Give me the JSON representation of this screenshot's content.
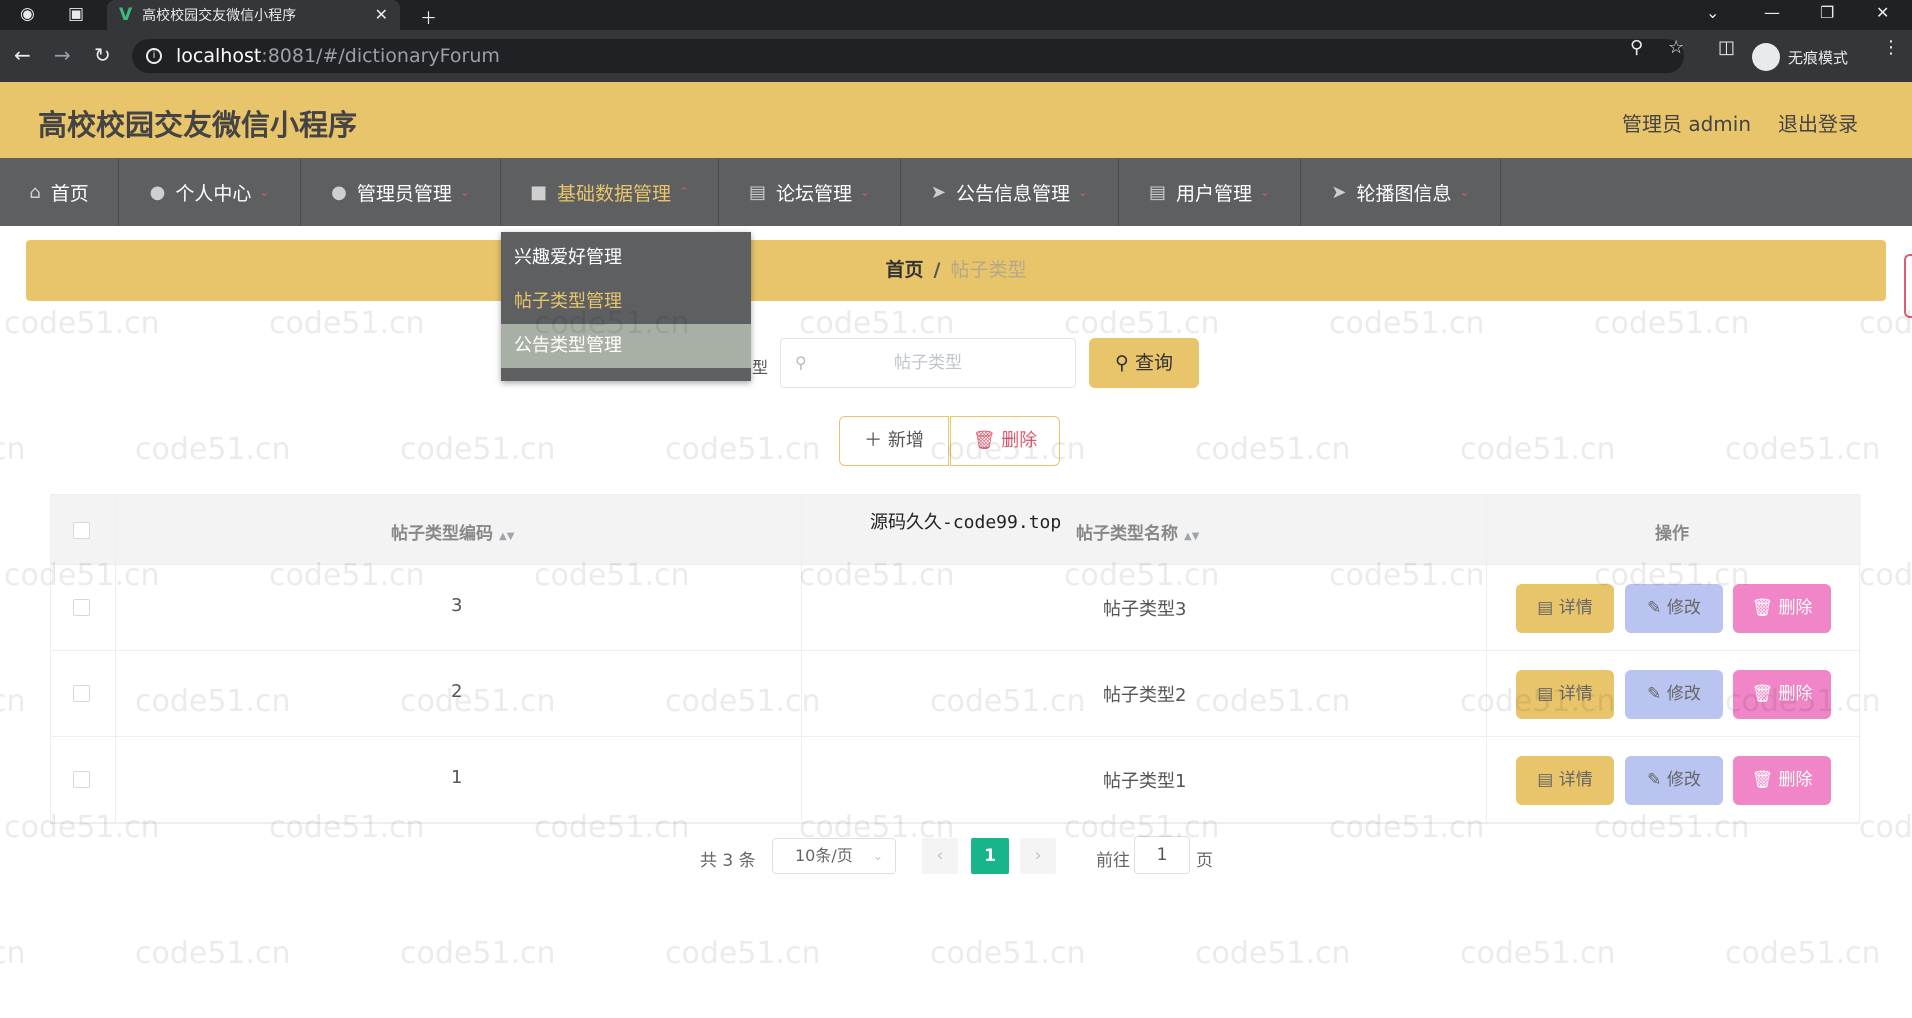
{
  "browser": {
    "tab_title": "高校校园交友微信小程序",
    "url_host": "localhost",
    "url_path": ":8081/#/dictionaryForum",
    "incognito_label": "无痕模式"
  },
  "header": {
    "title": "高校校园交友微信小程序",
    "admin_label": "管理员 admin",
    "logout_label": "退出登录"
  },
  "nav": {
    "items": [
      {
        "label": "首页",
        "icon": "home-icon"
      },
      {
        "label": "个人中心",
        "icon": "user-icon"
      },
      {
        "label": "管理员管理",
        "icon": "user-icon"
      },
      {
        "label": "基础数据管理",
        "icon": "data-icon"
      },
      {
        "label": "论坛管理",
        "icon": "forum-icon"
      },
      {
        "label": "公告信息管理",
        "icon": "send-icon"
      },
      {
        "label": "用户管理",
        "icon": "list-icon"
      },
      {
        "label": "轮播图信息",
        "icon": "send-icon"
      }
    ]
  },
  "dropdown": {
    "items": [
      "兴趣爱好管理",
      "帖子类型管理",
      "公告类型管理"
    ]
  },
  "breadcrumb": {
    "home": "首页",
    "separator": "/",
    "current": "帖子类型"
  },
  "search": {
    "label": "型",
    "placeholder": "帖子类型",
    "button": "查询"
  },
  "actions": {
    "add": "新增",
    "delete": "删除"
  },
  "table": {
    "headers": [
      "帖子类型编码",
      "帖子类型名称",
      "操作"
    ],
    "rows": [
      {
        "code": "3",
        "name": "帖子类型3"
      },
      {
        "code": "2",
        "name": "帖子类型2"
      },
      {
        "code": "1",
        "name": "帖子类型1"
      }
    ],
    "row_actions": {
      "detail": "详情",
      "edit": "修改",
      "delete": "删除"
    }
  },
  "pagination": {
    "total": "共 3 条",
    "page_size": "10条/页",
    "current_page": "1",
    "goto_prefix": "前往",
    "goto_value": "1",
    "goto_suffix": "页"
  },
  "watermark": {
    "text": "code51.cn",
    "overlay": "源码久久-code99.top"
  },
  "colors": {
    "accent": "#e8c56b",
    "nav_bg": "#5e5f61",
    "pagination_active": "#19b58a",
    "edit_button": "#b9c4f0",
    "delete_button": "#f086c7"
  }
}
